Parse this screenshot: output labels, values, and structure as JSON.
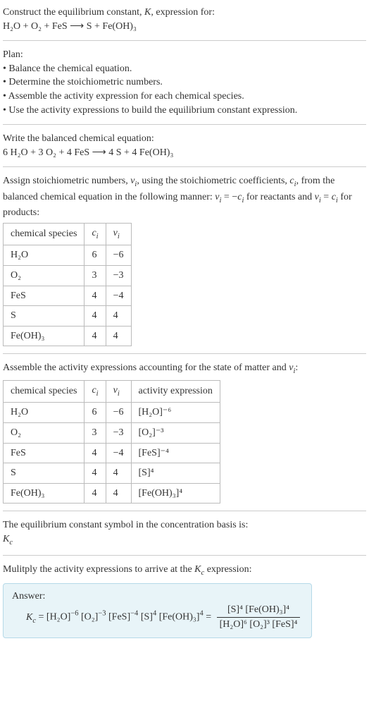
{
  "header": {
    "line1": "Construct the equilibrium constant, K, expression for:",
    "eq": "H₂O + O₂ + FeS ⟶ S + Fe(OH)₃"
  },
  "plan": {
    "title": "Plan:",
    "b1": "• Balance the chemical equation.",
    "b2": "• Determine the stoichiometric numbers.",
    "b3": "• Assemble the activity expression for each chemical species.",
    "b4": "• Use the activity expressions to build the equilibrium constant expression."
  },
  "balanced": {
    "title": "Write the balanced chemical equation:",
    "eq": "6 H₂O + 3 O₂ + 4 FeS ⟶ 4 S + 4 Fe(OH)₃"
  },
  "assign": {
    "text": "Assign stoichiometric numbers, νᵢ, using the stoichiometric coefficients, cᵢ, from the balanced chemical equation in the following manner: νᵢ = −cᵢ for reactants and νᵢ = cᵢ for products:"
  },
  "table1": {
    "h1": "chemical species",
    "h2": "cᵢ",
    "h3": "νᵢ",
    "rows": [
      {
        "s": "H₂O",
        "c": "6",
        "v": "−6"
      },
      {
        "s": "O₂",
        "c": "3",
        "v": "−3"
      },
      {
        "s": "FeS",
        "c": "4",
        "v": "−4"
      },
      {
        "s": "S",
        "c": "4",
        "v": "4"
      },
      {
        "s": "Fe(OH)₃",
        "c": "4",
        "v": "4"
      }
    ]
  },
  "assemble": {
    "text": "Assemble the activity expressions accounting for the state of matter and νᵢ:"
  },
  "table2": {
    "h1": "chemical species",
    "h2": "cᵢ",
    "h3": "νᵢ",
    "h4": "activity expression",
    "rows": [
      {
        "s": "H₂O",
        "c": "6",
        "v": "−6",
        "a": "[H₂O]⁻⁶"
      },
      {
        "s": "O₂",
        "c": "3",
        "v": "−3",
        "a": "[O₂]⁻³"
      },
      {
        "s": "FeS",
        "c": "4",
        "v": "−4",
        "a": "[FeS]⁻⁴"
      },
      {
        "s": "S",
        "c": "4",
        "v": "4",
        "a": "[S]⁴"
      },
      {
        "s": "Fe(OH)₃",
        "c": "4",
        "v": "4",
        "a": "[Fe(OH)₃]⁴"
      }
    ]
  },
  "symbol": {
    "line1": "The equilibrium constant symbol in the concentration basis is:",
    "line2": "K𝒸"
  },
  "multiply": {
    "text": "Mulitply the activity expressions to arrive at the K𝒸 expression:"
  },
  "answer": {
    "label": "Answer:",
    "lhs": "K𝒸 = [H₂O]⁻⁶ [O₂]⁻³ [FeS]⁻⁴ [S]⁴ [Fe(OH)₃]⁴ = ",
    "num": "[S]⁴ [Fe(OH)₃]⁴",
    "den": "[H₂O]⁶ [O₂]³ [FeS]⁴"
  },
  "chart_data": {
    "type": "table",
    "tables": [
      {
        "columns": [
          "chemical species",
          "cᵢ",
          "νᵢ"
        ],
        "rows": [
          [
            "H₂O",
            6,
            -6
          ],
          [
            "O₂",
            3,
            -3
          ],
          [
            "FeS",
            4,
            -4
          ],
          [
            "S",
            4,
            4
          ],
          [
            "Fe(OH)₃",
            4,
            4
          ]
        ]
      },
      {
        "columns": [
          "chemical species",
          "cᵢ",
          "νᵢ",
          "activity expression"
        ],
        "rows": [
          [
            "H₂O",
            6,
            -6,
            "[H₂O]^-6"
          ],
          [
            "O₂",
            3,
            -3,
            "[O₂]^-3"
          ],
          [
            "FeS",
            4,
            -4,
            "[FeS]^-4"
          ],
          [
            "S",
            4,
            4,
            "[S]^4"
          ],
          [
            "Fe(OH)₃",
            4,
            4,
            "[Fe(OH)₃]^4"
          ]
        ]
      }
    ]
  }
}
